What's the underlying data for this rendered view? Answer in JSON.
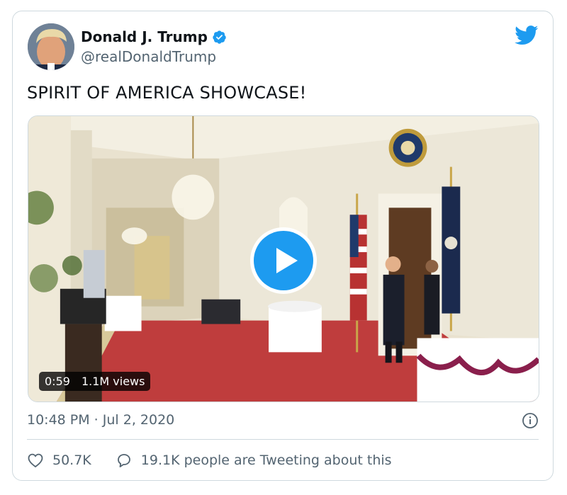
{
  "user": {
    "display_name": "Donald J. Trump",
    "handle": "@realDonaldTrump",
    "verified": true
  },
  "tweet": {
    "text": "SPIRIT OF AMERICA SHOWCASE!",
    "timestamp": "10:48 PM · Jul 2, 2020"
  },
  "video": {
    "duration": "0:59",
    "views": "1.1M views"
  },
  "actions": {
    "likes": "50.7K",
    "conversation": "19.1K people are Tweeting about this"
  },
  "icons": {
    "logo": "twitter-bird-icon",
    "verified": "verified-badge-icon",
    "info": "info-icon",
    "like": "heart-icon",
    "reply": "speech-bubble-icon",
    "play": "play-icon"
  },
  "colors": {
    "accent": "#1d9bf0",
    "text": "#0f1419",
    "secondary": "#536471",
    "border": "#cfd9de"
  }
}
